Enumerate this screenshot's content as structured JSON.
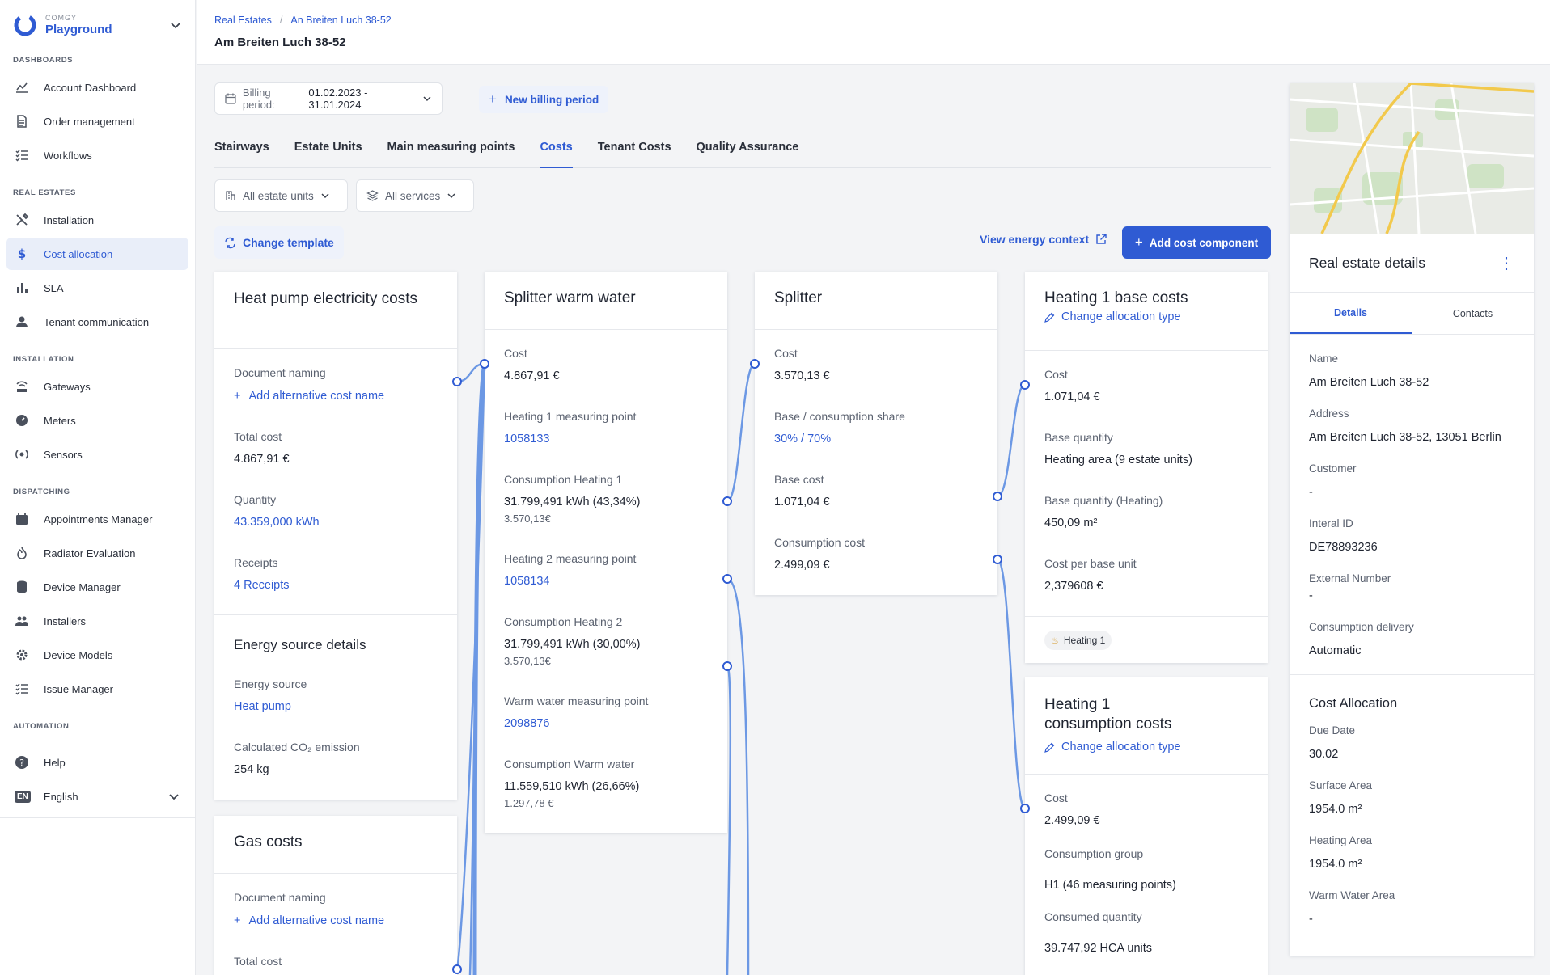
{
  "brand": {
    "small": "COMGY",
    "name": "Playground"
  },
  "sidebar": {
    "sections": [
      {
        "title": "DASHBOARDS",
        "items": [
          {
            "label": "Account Dashboard",
            "icon": "chart-line-icon"
          },
          {
            "label": "Order management",
            "icon": "document-icon"
          },
          {
            "label": "Workflows",
            "icon": "list-check-icon"
          }
        ]
      },
      {
        "title": "REAL ESTATES",
        "items": [
          {
            "label": "Installation",
            "icon": "tools-icon"
          },
          {
            "label": "Cost allocation",
            "icon": "dollar-icon",
            "active": true
          },
          {
            "label": "SLA",
            "icon": "bar-chart-icon"
          },
          {
            "label": "Tenant communication",
            "icon": "person-icon"
          }
        ]
      },
      {
        "title": "INSTALLATION",
        "items": [
          {
            "label": "Gateways",
            "icon": "gateway-icon"
          },
          {
            "label": "Meters",
            "icon": "meter-icon"
          },
          {
            "label": "Sensors",
            "icon": "sensor-icon"
          }
        ]
      },
      {
        "title": "DISPATCHING",
        "items": [
          {
            "label": "Appointments Manager",
            "icon": "calendar-icon"
          },
          {
            "label": "Radiator Evaluation",
            "icon": "flame-icon"
          },
          {
            "label": "Device Manager",
            "icon": "database-icon"
          },
          {
            "label": "Installers",
            "icon": "people-icon"
          },
          {
            "label": "Device Models",
            "icon": "gear-icon"
          },
          {
            "label": "Issue Manager",
            "icon": "list-check-icon"
          }
        ]
      },
      {
        "title": "AUTOMATION",
        "items": []
      }
    ],
    "help_label": "Help",
    "language_code": "EN",
    "language_label": "English"
  },
  "header": {
    "breadcrumb": [
      "Real Estates",
      "An Breiten Luch 38-52"
    ],
    "title": "Am Breiten Luch 38-52"
  },
  "toolbar": {
    "billing_label": "Billing period:",
    "billing_value": "01.02.2023 - 31.01.2024",
    "new_billing_label": "New billing period",
    "tabs": [
      "Stairways",
      "Estate Units",
      "Main measuring points",
      "Costs",
      "Tenant Costs",
      "Quality Assurance"
    ],
    "active_tab": "Costs",
    "filter_units": "All estate units",
    "filter_services": "All services",
    "change_template": "Change template",
    "view_energy_context": "View energy context",
    "add_cost_component": "Add cost component"
  },
  "cards": {
    "heatpump": {
      "title": "Heat pump electricity costs",
      "doc_naming_label": "Document naming",
      "add_alt_name": "Add alternative cost name",
      "total_cost_label": "Total cost",
      "total_cost": "4.867,91 €",
      "quantity_label": "Quantity",
      "quantity": "43.359,000 kWh",
      "receipts_label": "Receipts",
      "receipts": "4 Receipts",
      "energy_section": "Energy source details",
      "energy_source_label": "Energy source",
      "energy_source": "Heat pump",
      "co2_label": "Calculated CO₂ emission",
      "co2": "254 kg"
    },
    "gas": {
      "title": "Gas costs",
      "doc_naming_label": "Document naming",
      "add_alt_name": "Add alternative cost name",
      "total_cost_label": "Total cost"
    },
    "splitter_ww": {
      "title": "Splitter warm water",
      "cost_label": "Cost",
      "cost": "4.867,91 €",
      "h1_mp_label": "Heating 1 measuring point",
      "h1_mp": "1058133",
      "cons_h1_label": "Consumption Heating 1",
      "cons_h1": "31.799,491 kWh (43,34%)",
      "cons_h1_sub": "3.570,13€",
      "h2_mp_label": "Heating 2 measuring point",
      "h2_mp": "1058134",
      "cons_h2_label": "Consumption Heating 2",
      "cons_h2": "31.799,491 kWh (30,00%)",
      "cons_h2_sub": "3.570,13€",
      "ww_mp_label": "Warm water measuring point",
      "ww_mp": "2098876",
      "cons_ww_label": "Consumption Warm water",
      "cons_ww": "11.559,510 kWh (26,66%)",
      "cons_ww_sub": "1.297,78 €"
    },
    "splitter": {
      "title": "Splitter",
      "cost_label": "Cost",
      "cost": "3.570,13 €",
      "share_label": "Base / consumption share",
      "share": "30% / 70%",
      "base_cost_label": "Base cost",
      "base_cost": "1.071,04 €",
      "cons_cost_label": "Consumption cost",
      "cons_cost": "2.499,09 €"
    },
    "h1base": {
      "title": "Heating 1 base costs",
      "change_alloc": "Change allocation type",
      "cost_label": "Cost",
      "cost": "1.071,04 €",
      "base_qty_label": "Base quantity",
      "base_qty": "Heating area (9 estate units)",
      "base_qty_h_label": "Base quantity (Heating)",
      "base_qty_h": "450,09 m²",
      "cpu_label": "Cost per base unit",
      "cpu": "2,379608 €",
      "tag": "Heating 1"
    },
    "h1cons": {
      "title_line1": "Heating 1",
      "title_line2": "consumption costs",
      "change_alloc": "Change allocation type",
      "cost_label": "Cost",
      "cost": "2.499,09 €",
      "group_label": "Consumption group",
      "group": "H1 (46 measuring points)",
      "consumed_label": "Consumed quantity",
      "consumed": "39.747,92 HCA units"
    }
  },
  "details": {
    "title": "Real estate details",
    "tabs": [
      "Details",
      "Contacts"
    ],
    "fields": [
      {
        "label": "Name",
        "value": "Am Breiten Luch 38-52"
      },
      {
        "label": "Address",
        "value": "Am Breiten Luch 38-52, 13051 Berlin"
      },
      {
        "label": "Customer",
        "value": "-"
      },
      {
        "label": "Interal ID",
        "value": "DE78893236"
      },
      {
        "label": "External Number",
        "value": "-"
      },
      {
        "label": "Consumption delivery",
        "value": "Automatic"
      }
    ],
    "alloc_title": "Cost Allocation",
    "alloc_fields": [
      {
        "label": "Due Date",
        "value": "30.02"
      },
      {
        "label": "Surface Area",
        "value": "1954.0 m²"
      },
      {
        "label": "Heating Area",
        "value": "1954.0 m²"
      },
      {
        "label": "Warm Water Area",
        "value": "-"
      }
    ]
  },
  "colors": {
    "accent": "#2f5bd3",
    "connector": "#5b8de0"
  }
}
